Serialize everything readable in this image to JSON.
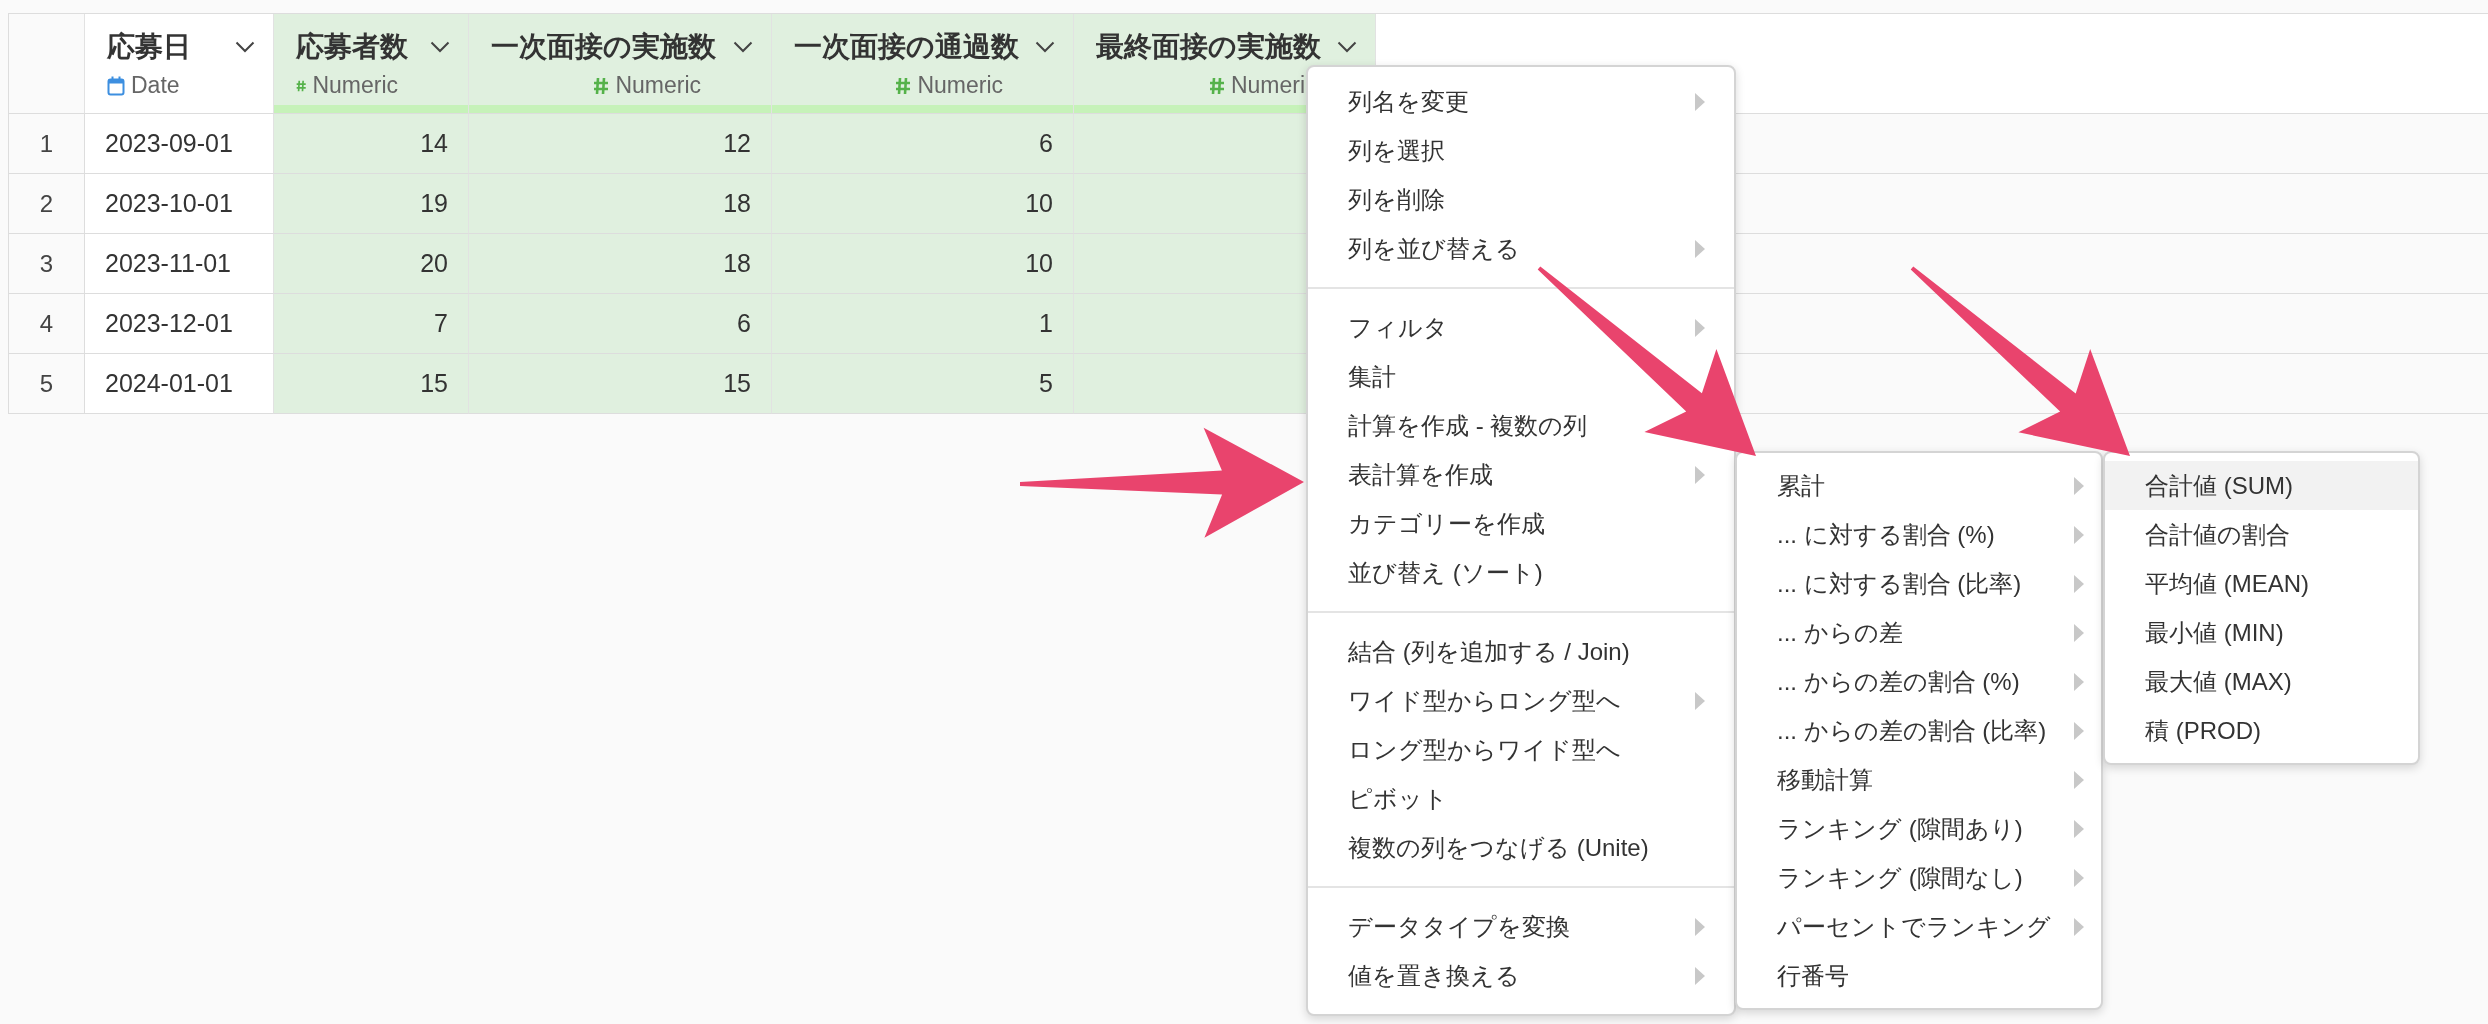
{
  "table": {
    "columns": [
      {
        "name": "応募日",
        "kind": "date",
        "type": "Date",
        "selected": false
      },
      {
        "name": "応募者数",
        "kind": "numeric",
        "type": "Numeric",
        "selected": true
      },
      {
        "name": "一次面接の実施数",
        "kind": "numeric",
        "type": "Numeric",
        "selected": true
      },
      {
        "name": "一次面接の通過数",
        "kind": "numeric",
        "type": "Numeric",
        "selected": true
      },
      {
        "name": "最終面接の実施数",
        "kind": "numeric",
        "type": "Numeri",
        "selected": true
      }
    ],
    "rows": [
      {
        "number": "1",
        "cells": [
          "2023-09-01",
          "14",
          "12",
          "6"
        ]
      },
      {
        "number": "2",
        "cells": [
          "2023-10-01",
          "19",
          "18",
          "10"
        ]
      },
      {
        "number": "3",
        "cells": [
          "2023-11-01",
          "20",
          "18",
          "10"
        ]
      },
      {
        "number": "4",
        "cells": [
          "2023-12-01",
          "7",
          "6",
          "1"
        ]
      },
      {
        "number": "5",
        "cells": [
          "2024-01-01",
          "15",
          "15",
          "5"
        ]
      }
    ]
  },
  "context_menu": {
    "sections": [
      [
        {
          "label": "列名を変更",
          "submenu": true,
          "selected": false
        },
        {
          "label": "列を選択",
          "submenu": false,
          "selected": false
        },
        {
          "label": "列を削除",
          "submenu": false,
          "selected": false
        },
        {
          "label": "列を並び替える",
          "submenu": true,
          "selected": false
        }
      ],
      [
        {
          "label": "フィルタ",
          "submenu": true,
          "selected": false
        },
        {
          "label": "集計",
          "submenu": false,
          "selected": false
        },
        {
          "label": "計算を作成 - 複数の列",
          "submenu": false,
          "selected": false
        },
        {
          "label": "表計算を作成",
          "submenu": true,
          "selected": false
        },
        {
          "label": "カテゴリーを作成",
          "submenu": false,
          "selected": false
        },
        {
          "label": "並び替え (ソート)",
          "submenu": false,
          "selected": false
        }
      ],
      [
        {
          "label": "結合 (列を追加する / Join)",
          "submenu": false,
          "selected": false
        },
        {
          "label": "ワイド型からロング型へ",
          "submenu": true,
          "selected": false
        },
        {
          "label": "ロング型からワイド型へ",
          "submenu": false,
          "selected": false
        },
        {
          "label": "ピボット",
          "submenu": false,
          "selected": false
        },
        {
          "label": "複数の列をつなげる (Unite)",
          "submenu": false,
          "selected": false
        }
      ],
      [
        {
          "label": "データタイプを変換",
          "submenu": true,
          "selected": false
        },
        {
          "label": "値を置き換える",
          "submenu": true,
          "selected": false
        }
      ]
    ]
  },
  "table_calc_submenu": {
    "items": [
      {
        "label": "累計",
        "submenu": true,
        "selected": false
      },
      {
        "label": "... に対する割合 (%)",
        "submenu": true,
        "selected": false
      },
      {
        "label": "... に対する割合 (比率)",
        "submenu": true,
        "selected": false
      },
      {
        "label": "... からの差",
        "submenu": true,
        "selected": false
      },
      {
        "label": "... からの差の割合 (%)",
        "submenu": true,
        "selected": false
      },
      {
        "label": "... からの差の割合 (比率)",
        "submenu": true,
        "selected": false
      },
      {
        "label": "移動計算",
        "submenu": true,
        "selected": false
      },
      {
        "label": "ランキング (隙間あり)",
        "submenu": true,
        "selected": false
      },
      {
        "label": "ランキング (隙間なし)",
        "submenu": true,
        "selected": false
      },
      {
        "label": "パーセントでランキング",
        "submenu": true,
        "selected": false
      },
      {
        "label": "行番号",
        "submenu": false,
        "selected": false
      }
    ]
  },
  "cumulative_submenu": {
    "items": [
      {
        "label": "合計値 (SUM)",
        "submenu": false,
        "selected": true
      },
      {
        "label": "合計値の割合",
        "submenu": false,
        "selected": false
      },
      {
        "label": "平均値 (MEAN)",
        "submenu": false,
        "selected": false
      },
      {
        "label": "最小値 (MIN)",
        "submenu": false,
        "selected": false
      },
      {
        "label": "最大値 (MAX)",
        "submenu": false,
        "selected": false
      },
      {
        "label": "積 (PROD)",
        "submenu": false,
        "selected": false
      }
    ]
  }
}
